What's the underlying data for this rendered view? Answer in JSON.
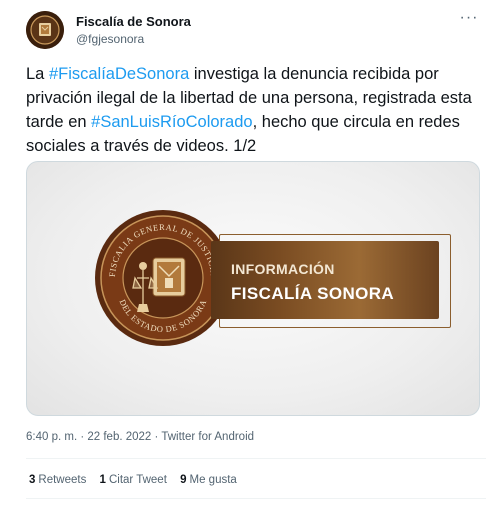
{
  "account": {
    "name": "Fiscalía de Sonora",
    "handle": "@fgjesonora"
  },
  "tweet": {
    "parts": [
      {
        "type": "text",
        "value": "La "
      },
      {
        "type": "hashtag",
        "value": "#FiscalíaDeSonora"
      },
      {
        "type": "text",
        "value": " investiga la denuncia recibida por privación ilegal de la libertad de una persona, registrada esta tarde en "
      },
      {
        "type": "hashtag",
        "value": "#SanLuisRíoColorado"
      },
      {
        "type": "text",
        "value": ", hecho que circula en redes sociales a través de videos. 1/2"
      }
    ]
  },
  "media": {
    "seal_text_top": "FISCALIA GENERAL DE JUSTICIA",
    "seal_text_bottom": "DEL ESTADO DE SONORA",
    "banner_line1": "INFORMACIÓN",
    "banner_line2": "FISCALÍA SONORA"
  },
  "meta": {
    "time": "6:40 p. m.",
    "separator": " · ",
    "date": "22 feb. 2022",
    "source": "Twitter for Android"
  },
  "stats": {
    "retweets_count": "3",
    "retweets_label": "Retweets",
    "quotes_count": "1",
    "quotes_label": "Citar Tweet",
    "likes_count": "9",
    "likes_label": "Me gusta"
  },
  "icons": {
    "more": "more-options-icon",
    "avatar": "fiscalia-logo"
  },
  "colors": {
    "link": "#1d9bf0",
    "secondary_text": "#536471",
    "primary_text": "#0f1419",
    "banner_gold": "#9b6a35",
    "seal_brown": "#5a2a10"
  }
}
